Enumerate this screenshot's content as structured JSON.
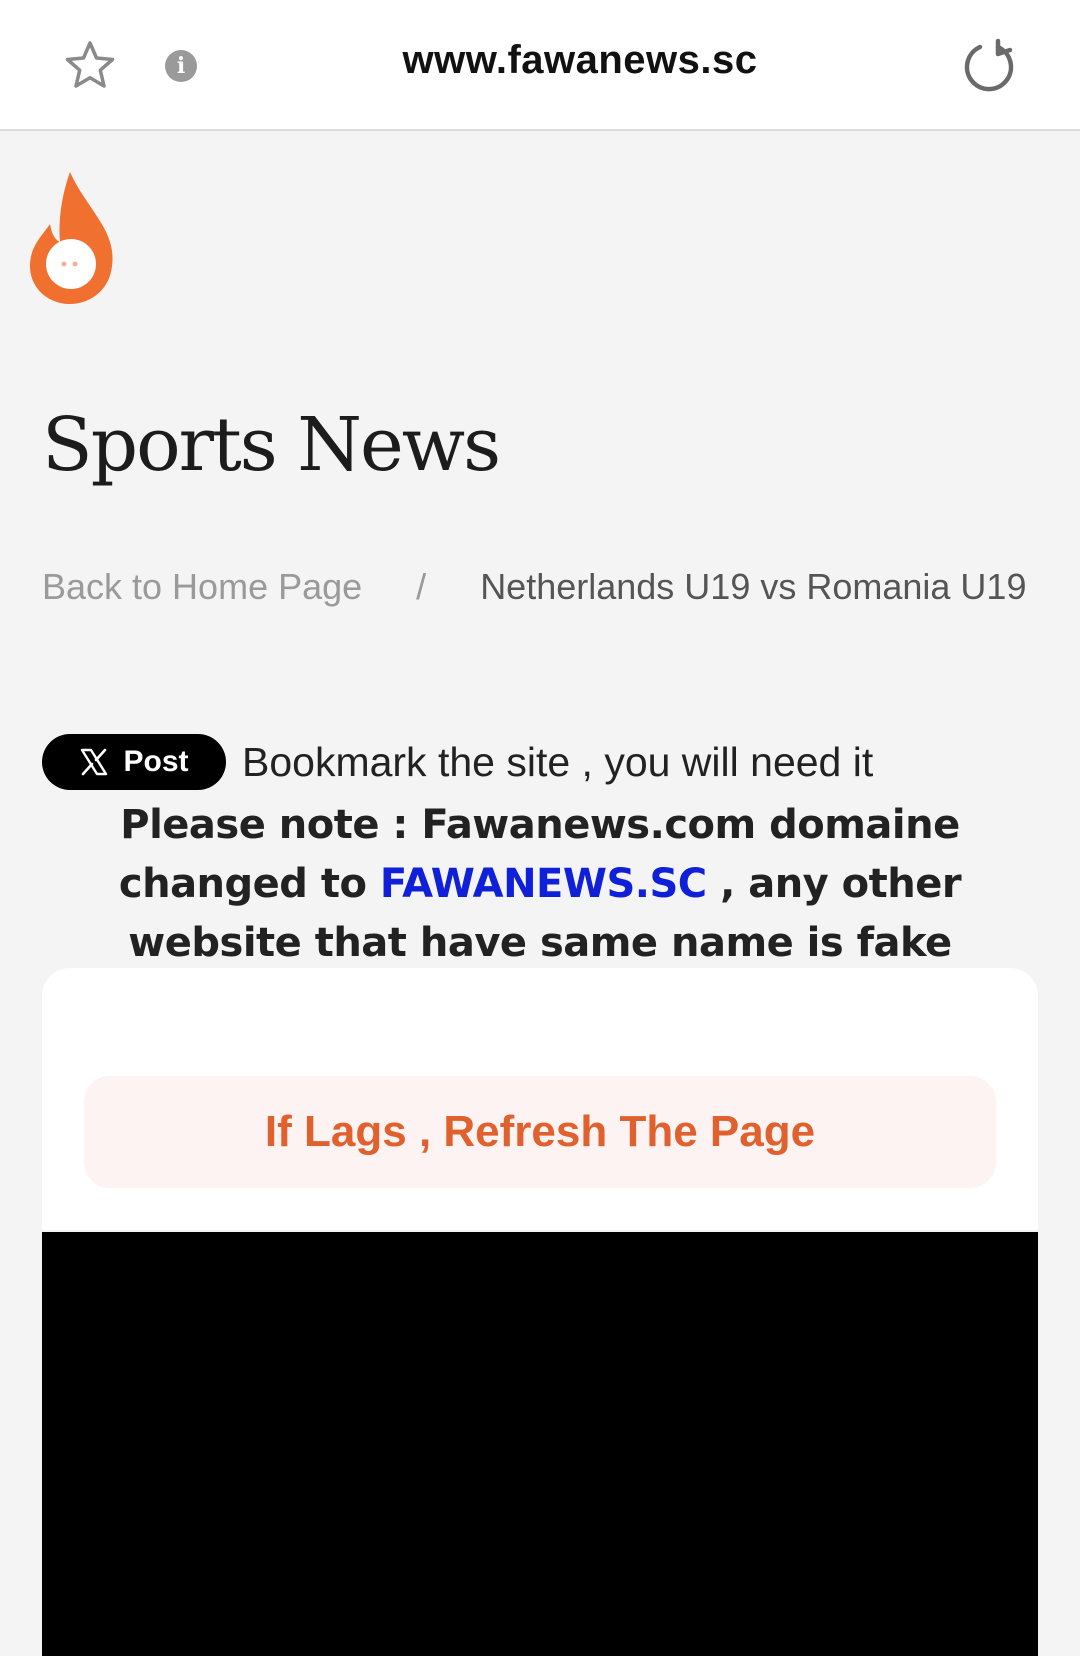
{
  "browser": {
    "url": "www.fawanews.sc",
    "icons": {
      "bookmark": "star-icon",
      "info": "info-icon",
      "reload": "reload-icon"
    }
  },
  "site": {
    "logo": "flame-logo",
    "title": "Sports News",
    "breadcrumb": {
      "home": "Back to Home Page",
      "separator": "/",
      "current": "Netherlands U19 vs Romania U19"
    }
  },
  "share": {
    "post_label": "Post",
    "bookmark_text": "Bookmark the site , you will need it"
  },
  "notice": {
    "before": "Please note : Fawanews.com domaine changed to",
    "domain": "FAWANEWS.SC",
    "after": ", any other website that have same name is fake"
  },
  "banner": {
    "text": "If Lags , Refresh The Page"
  },
  "colors": {
    "accent_orange": "#e0612d",
    "link_blue": "#1020d8",
    "background": "#f4f4f4"
  }
}
